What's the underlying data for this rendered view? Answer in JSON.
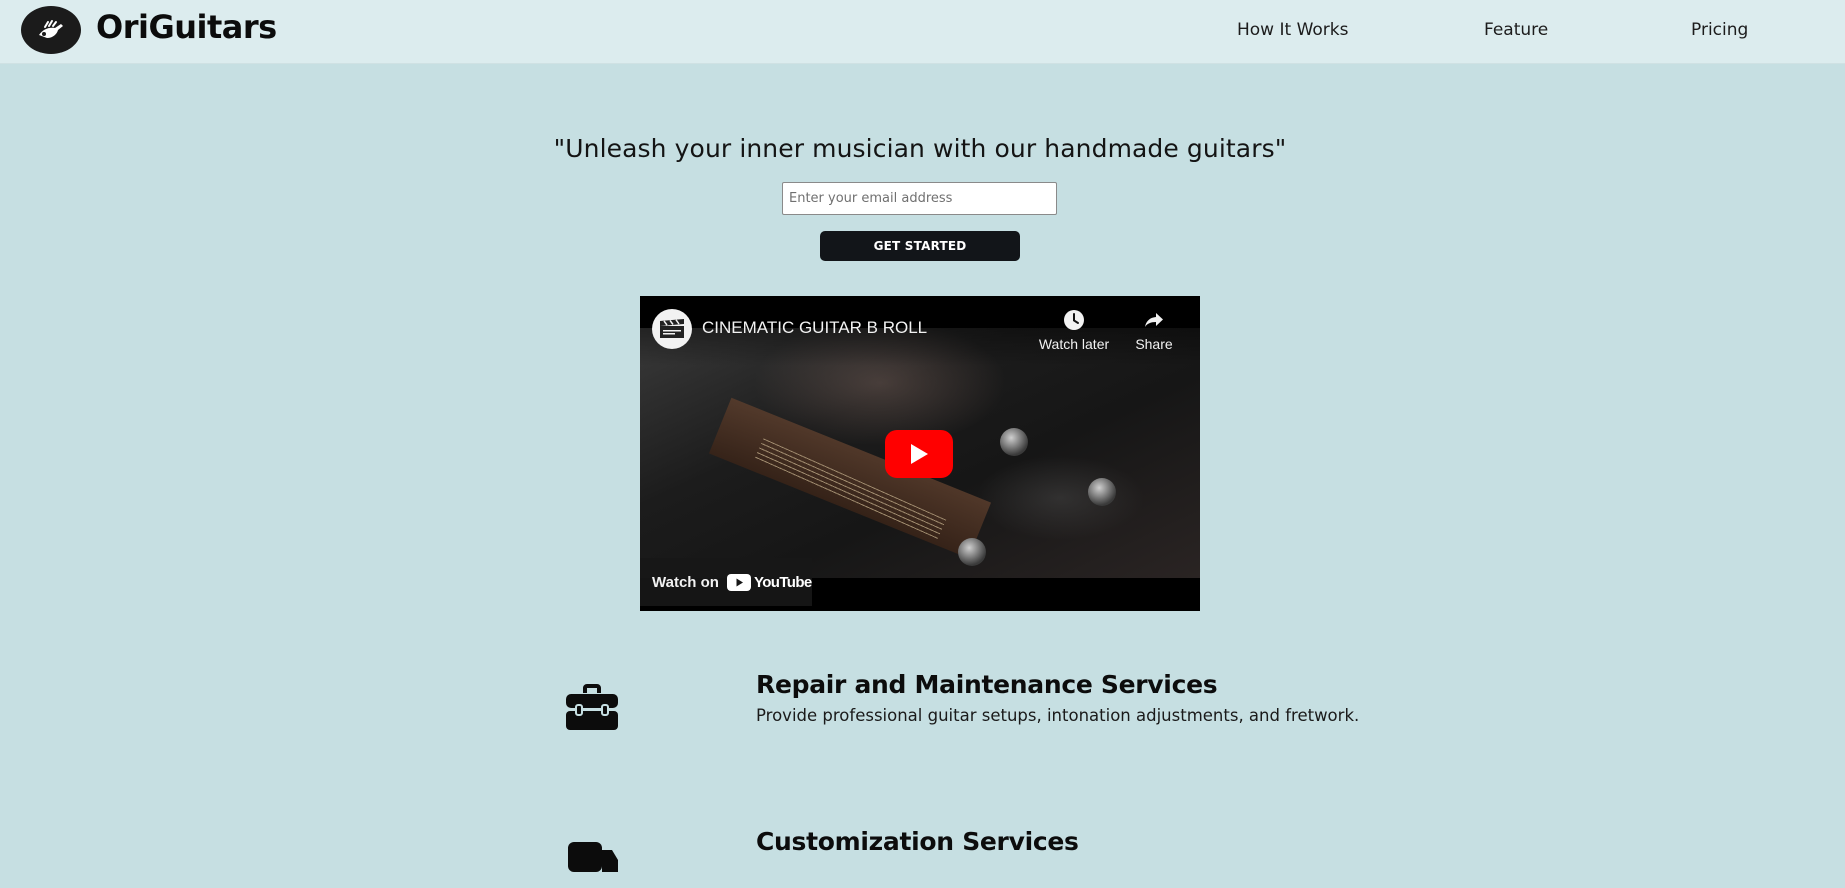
{
  "header": {
    "brand": "OriGuitars",
    "nav": [
      {
        "label": "How It Works"
      },
      {
        "label": "Feature"
      },
      {
        "label": "Pricing"
      }
    ]
  },
  "hero": {
    "tagline": "\"Unleash your inner musician with our handmade guitars\"",
    "email_placeholder": "Enter your email address",
    "email_value": "",
    "cta_label": "GET STARTED"
  },
  "video": {
    "title": "CINEMATIC GUITAR B ROLL",
    "watch_later_label": "Watch later",
    "share_label": "Share",
    "watch_on_label": "Watch on",
    "youtube_label": "YouTube"
  },
  "features": [
    {
      "icon": "toolbox-icon",
      "title": "Repair and Maintenance Services",
      "description": "Provide professional guitar setups, intonation adjustments, and fretwork."
    },
    {
      "icon": "truck-icon",
      "title": "Customization Services",
      "description": ""
    }
  ],
  "colors": {
    "page_background": "#c6dfe2",
    "header_background": "#dcecee",
    "button_background": "#121519",
    "youtube_red": "#ff0000"
  }
}
